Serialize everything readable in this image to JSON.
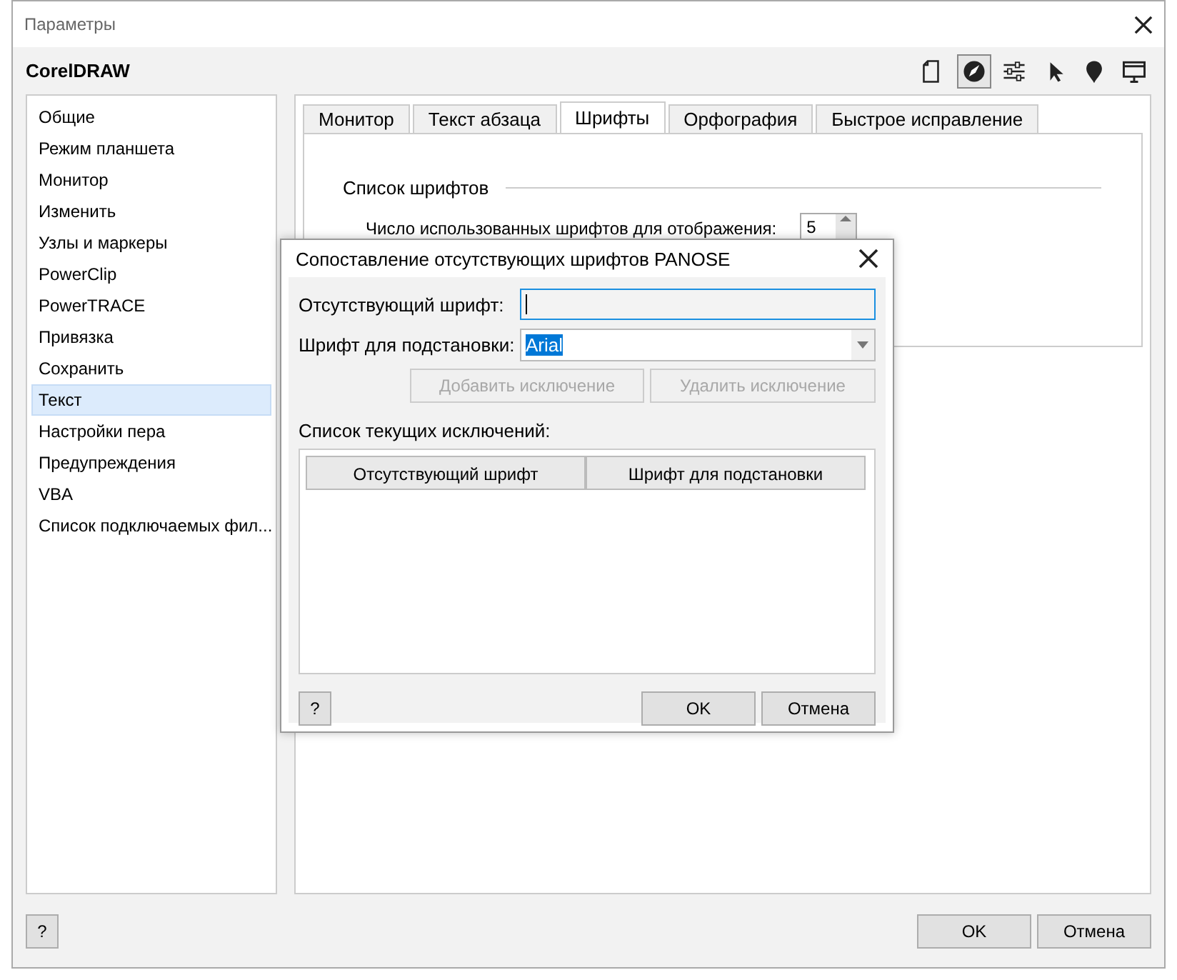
{
  "window": {
    "title": "Параметры"
  },
  "header": {
    "title": "CorelDRAW"
  },
  "toolbar": [
    {
      "kind": "page",
      "selected": false
    },
    {
      "kind": "pen",
      "selected": true
    },
    {
      "kind": "sliders",
      "selected": false
    },
    {
      "kind": "pointer",
      "selected": false
    },
    {
      "kind": "pin",
      "selected": false
    },
    {
      "kind": "monitor",
      "selected": false
    }
  ],
  "sidebar": {
    "items": [
      {
        "label": "Общие",
        "selected": false
      },
      {
        "label": "Режим планшета",
        "selected": false
      },
      {
        "label": "Монитор",
        "selected": false
      },
      {
        "label": "Изменить",
        "selected": false
      },
      {
        "label": "Узлы и маркеры",
        "selected": false
      },
      {
        "label": "PowerClip",
        "selected": false
      },
      {
        "label": "PowerTRACE",
        "selected": false
      },
      {
        "label": "Привязка",
        "selected": false
      },
      {
        "label": "Сохранить",
        "selected": false
      },
      {
        "label": "Текст",
        "selected": true
      },
      {
        "label": "Настройки пера",
        "selected": false
      },
      {
        "label": "Предупреждения",
        "selected": false
      },
      {
        "label": "VBA",
        "selected": false
      },
      {
        "label": "Список подключаемых фил...",
        "selected": false
      }
    ]
  },
  "tabs": [
    {
      "label": "Монитор",
      "selected": false
    },
    {
      "label": "Текст абзаца",
      "selected": false
    },
    {
      "label": "Шрифты",
      "selected": true
    },
    {
      "label": "Орфография",
      "selected": false
    },
    {
      "label": "Быстрое исправление",
      "selected": false
    }
  ],
  "fonts_page": {
    "section": "Список шрифтов",
    "recent_label": "Число использованных шрифтов для отображения:",
    "recent_value": "5"
  },
  "buttons": [
    {
      "kind": "help",
      "label": "?"
    },
    {
      "kind": "ok",
      "label": "OK"
    },
    {
      "kind": "cancel",
      "label": "Отмена"
    }
  ],
  "dialog": {
    "title": "Сопоставление отсутствующих шрифтов PANOSE",
    "missing_label": "Отсутствующий шрифт:",
    "missing_focused": true,
    "substitute_label": "Шрифт для подстановки:",
    "substitute_value": "Arial",
    "substitute_highlighted": true,
    "actions": [
      {
        "label": "Добавить исключение",
        "disabled": true
      },
      {
        "label": "Удалить исключение",
        "disabled": true
      }
    ],
    "list_label": "Список текущих исключений:",
    "columns": [
      "Отсутствующий шрифт",
      "Шрифт для подстановки"
    ],
    "buttons": [
      {
        "kind": "help",
        "label": "?"
      },
      {
        "kind": "ok",
        "label": "OK"
      },
      {
        "kind": "cancel",
        "label": "Отмена"
      }
    ]
  }
}
